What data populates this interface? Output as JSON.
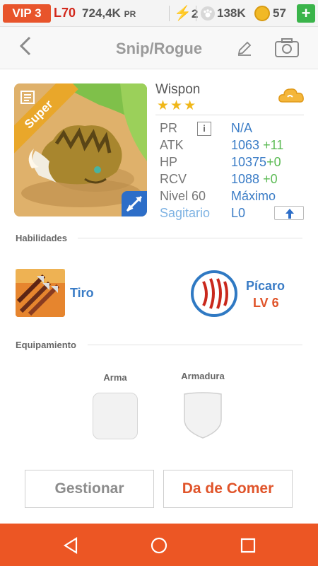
{
  "status": {
    "vip": "VIP 3",
    "level": "L70",
    "pr_value": "724,4K",
    "pr_unit": "PR",
    "energy": "2",
    "paw_count": "138K",
    "coins": "57",
    "add": "+"
  },
  "header": {
    "back_icon": "chevron-left-icon",
    "title": "Snip/Rogue",
    "edit_icon": "pencil-icon",
    "camera_icon": "camera-icon"
  },
  "card": {
    "badge": "Super",
    "name": "Wispon",
    "stars": "★★★",
    "stars_count": 3,
    "element_icon": "cloud-icon"
  },
  "stats": {
    "pr_label": "PR",
    "pr_info": "i",
    "pr_value": "N/A",
    "atk_label": "ATK",
    "atk_value": "1063",
    "atk_bonus": "+11",
    "hp_label": "HP",
    "hp_value": "10375",
    "hp_bonus": "+0",
    "rcv_label": "RCV",
    "rcv_value": "1088",
    "rcv_bonus": "+0",
    "level_label": "Nivel 60",
    "level_value": "Máximo",
    "sign_label": "Sagitario",
    "sign_value": "L0"
  },
  "skills": {
    "section": "Habilidades",
    "skill_name": "Tiro",
    "class_name": "Pícaro",
    "class_level": "LV 6"
  },
  "equipment": {
    "section": "Equipamiento",
    "weapon": "Arma",
    "armor": "Armadura"
  },
  "buttons": {
    "manage": "Gestionar",
    "feed": "Da de Comer"
  },
  "colors": {
    "accent": "#ec5624",
    "link": "#3a7cc6",
    "bonus": "#5cbb55",
    "star": "#f0b719"
  }
}
